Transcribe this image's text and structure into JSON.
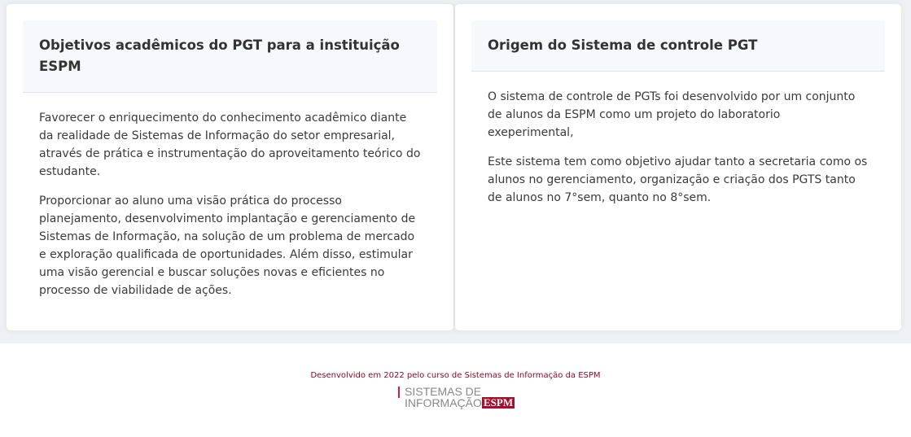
{
  "cards": [
    {
      "title": "Objetivos acadêmicos do PGT para a instituição ESPM",
      "paragraphs": [
        "Favorecer o enriquecimento do conhecimento acadêmico diante da realidade de Sistemas de Informação do setor empresarial, através de prática e instrumentação do aproveitamento teórico do estudante.",
        "Proporcionar ao aluno uma visão prática do processo planejamento, desenvolvimento implantação e gerenciamento de Sistemas de Informação, na solução de um problema de mercado e exploração qualificada de oportunidades. Além disso, estimular uma visão gerencial e buscar soluções novas e eficientes no processo de viabilidade de ações."
      ]
    },
    {
      "title": "Origem do Sistema de controle PGT",
      "paragraphs": [
        "O sistema de controle de PGTs foi desenvolvido por um conjunto de alunos da ESPM como um projeto do laboratorio exeperimental,",
        "Este sistema tem como objetivo ajudar tanto a secretaria como os alunos no gerenciamento, organização e criação dos PGTS tanto de alunos no 7°sem, quanto no 8°sem."
      ]
    }
  ],
  "footer": {
    "text": "Desenvolvido em 2022 pelo curso de Sistemas de Informação da ESPM",
    "logo_line1": "SISTEMAS DE",
    "logo_line2": "INFORMAÇÃO",
    "logo_brand": "ESPM"
  }
}
